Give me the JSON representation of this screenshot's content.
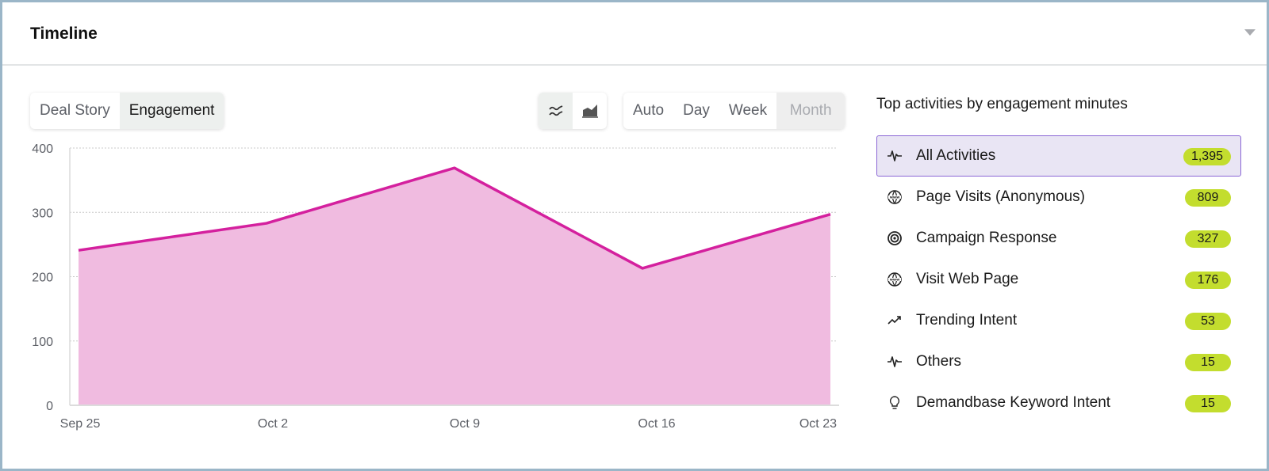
{
  "header": {
    "title": "Timeline",
    "collapse_icon": "caret-down-icon"
  },
  "view_tabs": [
    {
      "label": "Deal Story",
      "active": false
    },
    {
      "label": "Engagement",
      "active": true
    }
  ],
  "chart_type_toggle": [
    {
      "icon": "line-chart-icon",
      "active": true
    },
    {
      "icon": "area-chart-icon",
      "active": false
    }
  ],
  "period_options": [
    {
      "label": "Auto",
      "state": "normal"
    },
    {
      "label": "Day",
      "state": "normal"
    },
    {
      "label": "Week",
      "state": "normal"
    },
    {
      "label": "Month",
      "state": "disabled"
    }
  ],
  "activities": {
    "title": "Top activities by engagement minutes",
    "items": [
      {
        "label": "All Activities",
        "count": "1,395",
        "icon": "pulse-icon",
        "selected": true
      },
      {
        "label": "Page Visits (Anonymous)",
        "count": "809",
        "icon": "www-globe-icon",
        "selected": false
      },
      {
        "label": "Campaign Response",
        "count": "327",
        "icon": "target-icon",
        "selected": false
      },
      {
        "label": "Visit Web Page",
        "count": "176",
        "icon": "www-globe-icon",
        "selected": false
      },
      {
        "label": "Trending Intent",
        "count": "53",
        "icon": "trending-up-icon",
        "selected": false
      },
      {
        "label": "Others",
        "count": "15",
        "icon": "pulse-icon",
        "selected": false
      },
      {
        "label": "Demandbase Keyword Intent",
        "count": "15",
        "icon": "lightbulb-icon",
        "selected": false
      }
    ]
  },
  "colors": {
    "line": "#d4209e",
    "fill": "#f0bbe0",
    "badge": "#c3dd2e",
    "selected_border": "#8b67d6",
    "selected_bg": "#e9e5f4"
  },
  "chart_data": {
    "type": "area",
    "title": "",
    "xlabel": "",
    "ylabel": "",
    "categories": [
      "Sep 25",
      "Oct 2",
      "Oct 9",
      "Oct 16",
      "Oct 23"
    ],
    "series": [
      {
        "name": "All Activities",
        "values": [
          241,
          283,
          369,
          213,
          297
        ]
      }
    ],
    "ylim": [
      0,
      400
    ],
    "yticks": [
      0,
      100,
      200,
      300,
      400
    ],
    "grid": true,
    "legend": "none"
  }
}
